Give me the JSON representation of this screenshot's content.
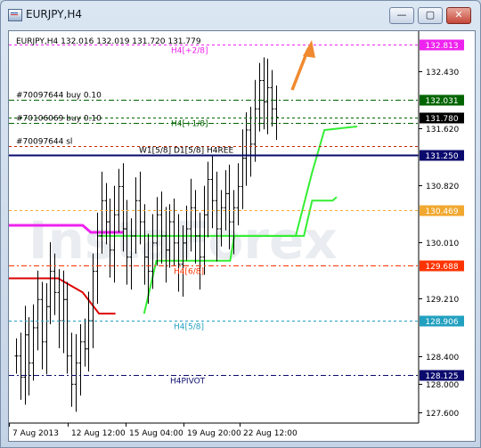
{
  "window": {
    "title": "EURJPY,H4",
    "minimize_label": "—",
    "maximize_label": "▢",
    "close_label": "✕"
  },
  "chart_header": "EURJPY,H4  132.016 132.019 131.720 131.779",
  "watermark": "InstaForex",
  "colors": {
    "price_bar": "#000000",
    "green_line": "#33ee33",
    "red_line": "#dd0000",
    "magenta_line": "#ee22ee",
    "arrow": "#f08a30",
    "navy": "#0a0a6e"
  },
  "chart_data": {
    "type": "candlestick",
    "symbol": "EURJPY",
    "timeframe": "H4",
    "ylim": [
      127.45,
      133.0
    ],
    "y_ticks": [
      "132.430",
      "131.620",
      "130.820",
      "130.010",
      "129.210",
      "128.400",
      "128.000",
      "127.600"
    ],
    "x_ticks": [
      "7 Aug 2013",
      "12 Aug 12:00",
      "15 Aug 04:00",
      "19 Aug 20:00",
      "22 Aug 12:00"
    ],
    "closes": [
      128.4,
      128.1,
      128.7,
      128.3,
      128.8,
      129.2,
      128.6,
      129.1,
      129.6,
      129.3,
      128.9,
      129.2,
      128.4,
      128.0,
      128.3,
      128.6,
      128.5,
      128.9,
      129.6,
      130.1,
      130.6,
      130.3,
      129.9,
      130.4,
      130.8,
      130.2,
      129.8,
      130.1,
      130.6,
      130.3,
      129.8,
      129.6,
      130.0,
      130.4,
      130.1,
      129.9,
      130.3,
      130.0,
      129.7,
      130.0,
      130.2,
      130.5,
      130.1,
      129.8,
      130.4,
      130.9,
      130.6,
      130.2,
      130.5,
      130.7,
      130.3,
      130.5,
      130.8,
      131.2,
      131.6,
      131.4,
      131.9,
      132.3,
      132.0,
      132.2,
      131.9,
      131.78
    ],
    "price_lines": [
      {
        "label": "H4[+2/8]",
        "price_text": "132.813",
        "value": 132.813,
        "color": "#ee22ee"
      },
      {
        "label": "#70097644 buy 0.10",
        "price_text": "132.031",
        "value": 132.031,
        "color": "#006400"
      },
      {
        "label": "H4[+1/8]",
        "price_text": "131.779",
        "value": 131.779,
        "color": "#006400"
      },
      {
        "label": "#70106069 buy 0.10",
        "price_text": "",
        "value": 131.7,
        "color": "#006400"
      },
      {
        "label": "#70097644 sl",
        "price_text": "",
        "value": 131.37,
        "color": "#cc2200"
      },
      {
        "label": "W1[5/8] D1[5/8] H4REE",
        "price_text": "131.250",
        "value": 131.25,
        "color": "#0a0a6e"
      },
      {
        "label": "",
        "price_text": "130.469",
        "value": 130.469,
        "color": "#f0a830"
      },
      {
        "label": "H4[6/8]",
        "price_text": "129.688",
        "value": 129.688,
        "color": "#ff3300"
      },
      {
        "label": "H4[5/8]",
        "price_text": "128.906",
        "value": 128.906,
        "color": "#22a0c0"
      },
      {
        "label": "H4PIVOT",
        "price_text": "128.125",
        "value": 128.125,
        "color": "#0a0a6e"
      }
    ],
    "green_stop_line": [
      [
        0.33,
        129.0
      ],
      [
        0.36,
        129.75
      ],
      [
        0.54,
        129.75
      ],
      [
        0.55,
        130.1
      ],
      [
        0.72,
        130.1
      ],
      [
        0.74,
        130.6
      ],
      [
        0.79,
        130.6
      ],
      [
        0.8,
        130.65
      ]
    ],
    "green_stop_line_upper": [
      [
        0.22,
        130.1
      ],
      [
        0.48,
        130.1
      ],
      [
        0.7,
        130.1
      ],
      [
        0.74,
        131.0
      ],
      [
        0.77,
        131.6
      ],
      [
        0.85,
        131.65
      ]
    ],
    "red_stop_line": [
      [
        0.0,
        129.5
      ],
      [
        0.12,
        129.5
      ],
      [
        0.18,
        129.3
      ],
      [
        0.22,
        129.0
      ],
      [
        0.26,
        129.0
      ]
    ],
    "magenta_stop_line": [
      [
        0.0,
        130.25
      ],
      [
        0.18,
        130.25
      ],
      [
        0.2,
        130.15
      ],
      [
        0.28,
        130.15
      ]
    ]
  }
}
